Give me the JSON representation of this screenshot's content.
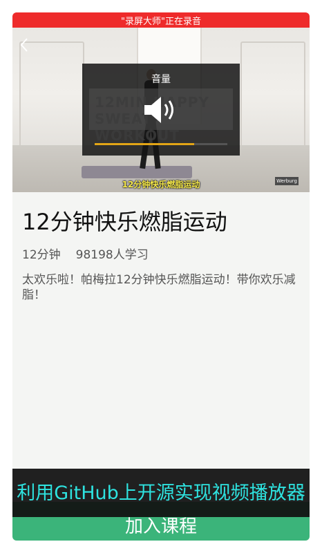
{
  "recording_bar": {
    "text": "\"录屏大师\"正在录音"
  },
  "video": {
    "caption": "12分钟快乐燃脂运动",
    "watermark": "12MIN HAPPY SWEAT WORKOUT",
    "brand": "Werburg"
  },
  "volume_overlay": {
    "title": "音量",
    "level": 0.75,
    "accent_color": "#e3a516"
  },
  "course": {
    "title": "12分钟快乐燃脂运动",
    "duration": "12分钟",
    "learners": "98198人学习",
    "description": "太欢乐啦！帕梅拉12分钟快乐燃脂运动！带你欢乐减脂！"
  },
  "join_button": {
    "label": "加入课程",
    "color": "#3bb47a"
  },
  "overlay_banner": {
    "text": "利用GitHub上开源实现视频播放器",
    "color": "#2ee3e0"
  },
  "icons": {
    "back": "chevron-left-icon",
    "volume": "speaker-icon"
  }
}
